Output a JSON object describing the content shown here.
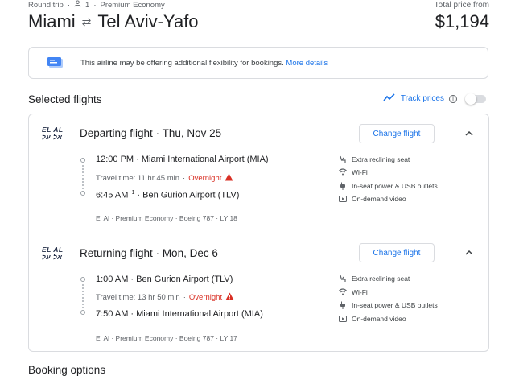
{
  "header": {
    "trip_type": "Round trip",
    "passengers": "1",
    "cabin": "Premium Economy",
    "origin": "Miami",
    "destination": "Tel Aviv-Yafo",
    "price_label": "Total price from",
    "price": "$1,194"
  },
  "notice": {
    "text": "This airline may be offering additional flexibility for bookings.",
    "link": "More details"
  },
  "selected": {
    "title": "Selected flights",
    "track_label": "Track prices"
  },
  "flights": [
    {
      "logo_line1": "EL AL",
      "logo_line2": "אל על",
      "direction": "Departing flight",
      "date": "Thu, Nov 25",
      "change_label": "Change flight",
      "dep_time": "12:00 PM",
      "dep_airport": "Miami International Airport (MIA)",
      "travel_time": "Travel time: 11 hr 45 min",
      "overnight": "Overnight",
      "arr_time": "6:45 AM",
      "arr_plus": "+1",
      "arr_airport": "Ben Gurion Airport (TLV)",
      "footer": "El Al · Premium Economy · Boeing 787 · LY 18",
      "amenities": [
        "Extra reclining seat",
        "Wi-Fi",
        "In-seat power & USB outlets",
        "On-demand video"
      ]
    },
    {
      "logo_line1": "EL AL",
      "logo_line2": "אל על",
      "direction": "Returning flight",
      "date": "Mon, Dec 6",
      "change_label": "Change flight",
      "dep_time": "1:00 AM",
      "dep_airport": "Ben Gurion Airport (TLV)",
      "travel_time": "Travel time: 13 hr 50 min",
      "overnight": "Overnight",
      "arr_time": "7:50 AM",
      "arr_airport": "Miami International Airport (MIA)",
      "footer": "El Al · Premium Economy · Boeing 787 · LY 17",
      "amenities": [
        "Extra reclining seat",
        "Wi-Fi",
        "In-seat power & USB outlets",
        "On-demand video"
      ]
    }
  ],
  "booking": {
    "title": "Booking options"
  },
  "colors": {
    "accent": "#1a73e8",
    "warning": "#d93025",
    "border": "#dadce0",
    "text": "#202124",
    "muted": "#5f6368"
  }
}
